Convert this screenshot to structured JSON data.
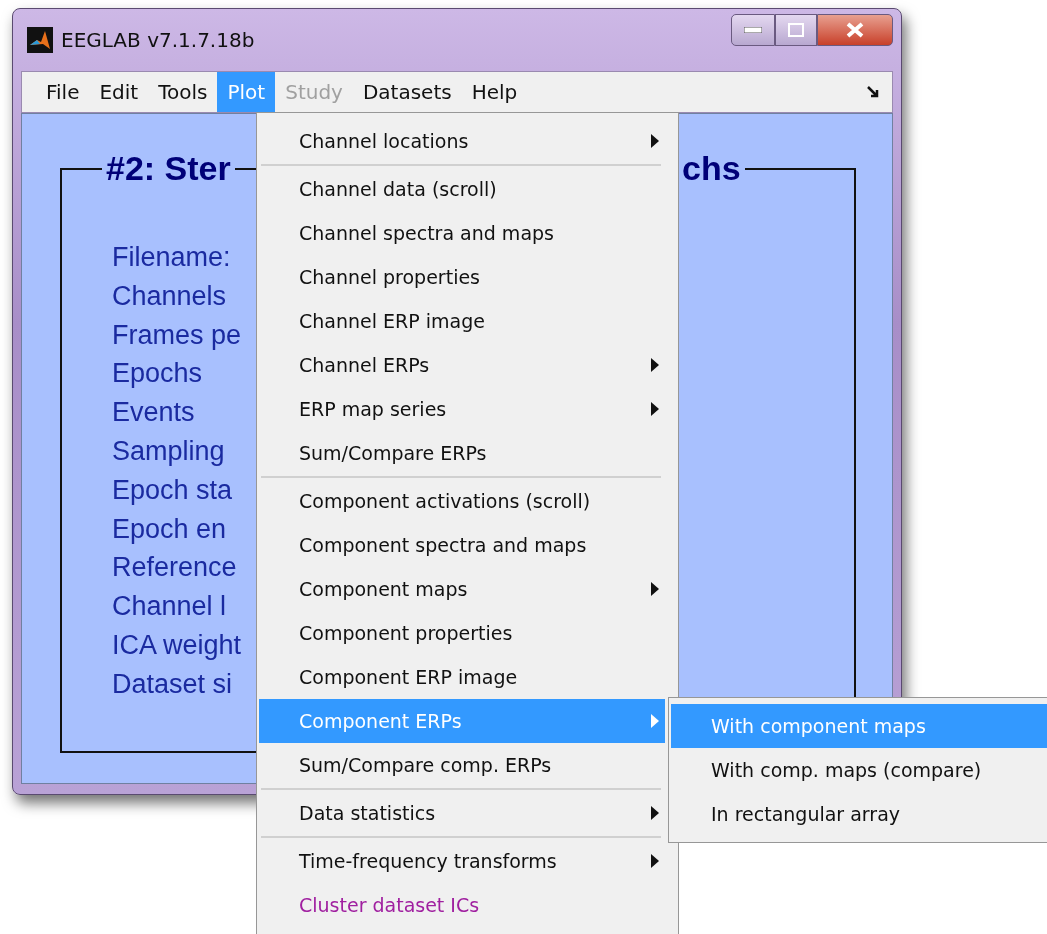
{
  "window": {
    "title": "EEGLAB v7.1.7.18b"
  },
  "menubar": [
    {
      "label": "File",
      "selected": false,
      "disabled": false
    },
    {
      "label": "Edit",
      "selected": false,
      "disabled": false
    },
    {
      "label": "Tools",
      "selected": false,
      "disabled": false
    },
    {
      "label": "Plot",
      "selected": true,
      "disabled": false
    },
    {
      "label": "Study",
      "selected": false,
      "disabled": true
    },
    {
      "label": "Datasets",
      "selected": false,
      "disabled": false
    },
    {
      "label": "Help",
      "selected": false,
      "disabled": false
    }
  ],
  "panel": {
    "title_left": "#2: Ster",
    "title_right": "chs",
    "labels": [
      "Filename:",
      "Channels",
      "Frames pe",
      "Epochs",
      "Events",
      "Sampling",
      "Epoch sta",
      "Epoch en",
      "Reference",
      "Channel l",
      "ICA weight",
      "Dataset si"
    ]
  },
  "plot_menu": {
    "groups": [
      [
        {
          "label": "Channel locations",
          "submenu": true,
          "selected": false
        }
      ],
      [
        {
          "label": "Channel data (scroll)",
          "submenu": false,
          "selected": false
        },
        {
          "label": "Channel spectra and maps",
          "submenu": false,
          "selected": false
        },
        {
          "label": "Channel properties",
          "submenu": false,
          "selected": false
        },
        {
          "label": "Channel ERP image",
          "submenu": false,
          "selected": false
        },
        {
          "label": "Channel ERPs",
          "submenu": true,
          "selected": false
        },
        {
          "label": "ERP map series",
          "submenu": true,
          "selected": false
        },
        {
          "label": "Sum/Compare ERPs",
          "submenu": false,
          "selected": false
        }
      ],
      [
        {
          "label": "Component activations (scroll)",
          "submenu": false,
          "selected": false
        },
        {
          "label": "Component spectra and maps",
          "submenu": false,
          "selected": false
        },
        {
          "label": "Component maps",
          "submenu": true,
          "selected": false
        },
        {
          "label": "Component properties",
          "submenu": false,
          "selected": false
        },
        {
          "label": "Component ERP image",
          "submenu": false,
          "selected": false
        },
        {
          "label": "Component ERPs",
          "submenu": true,
          "selected": true
        },
        {
          "label": "Sum/Compare comp. ERPs",
          "submenu": false,
          "selected": false
        }
      ],
      [
        {
          "label": "Data statistics",
          "submenu": true,
          "selected": false
        }
      ],
      [
        {
          "label": "Time-frequency transforms",
          "submenu": true,
          "selected": false
        },
        {
          "label": "Cluster dataset ICs",
          "submenu": false,
          "selected": false,
          "color": "#a020a0"
        }
      ]
    ]
  },
  "submenu": [
    {
      "label": "With component maps",
      "selected": true
    },
    {
      "label": "With comp. maps (compare)",
      "selected": false
    },
    {
      "label": "In rectangular array",
      "selected": false
    }
  ]
}
